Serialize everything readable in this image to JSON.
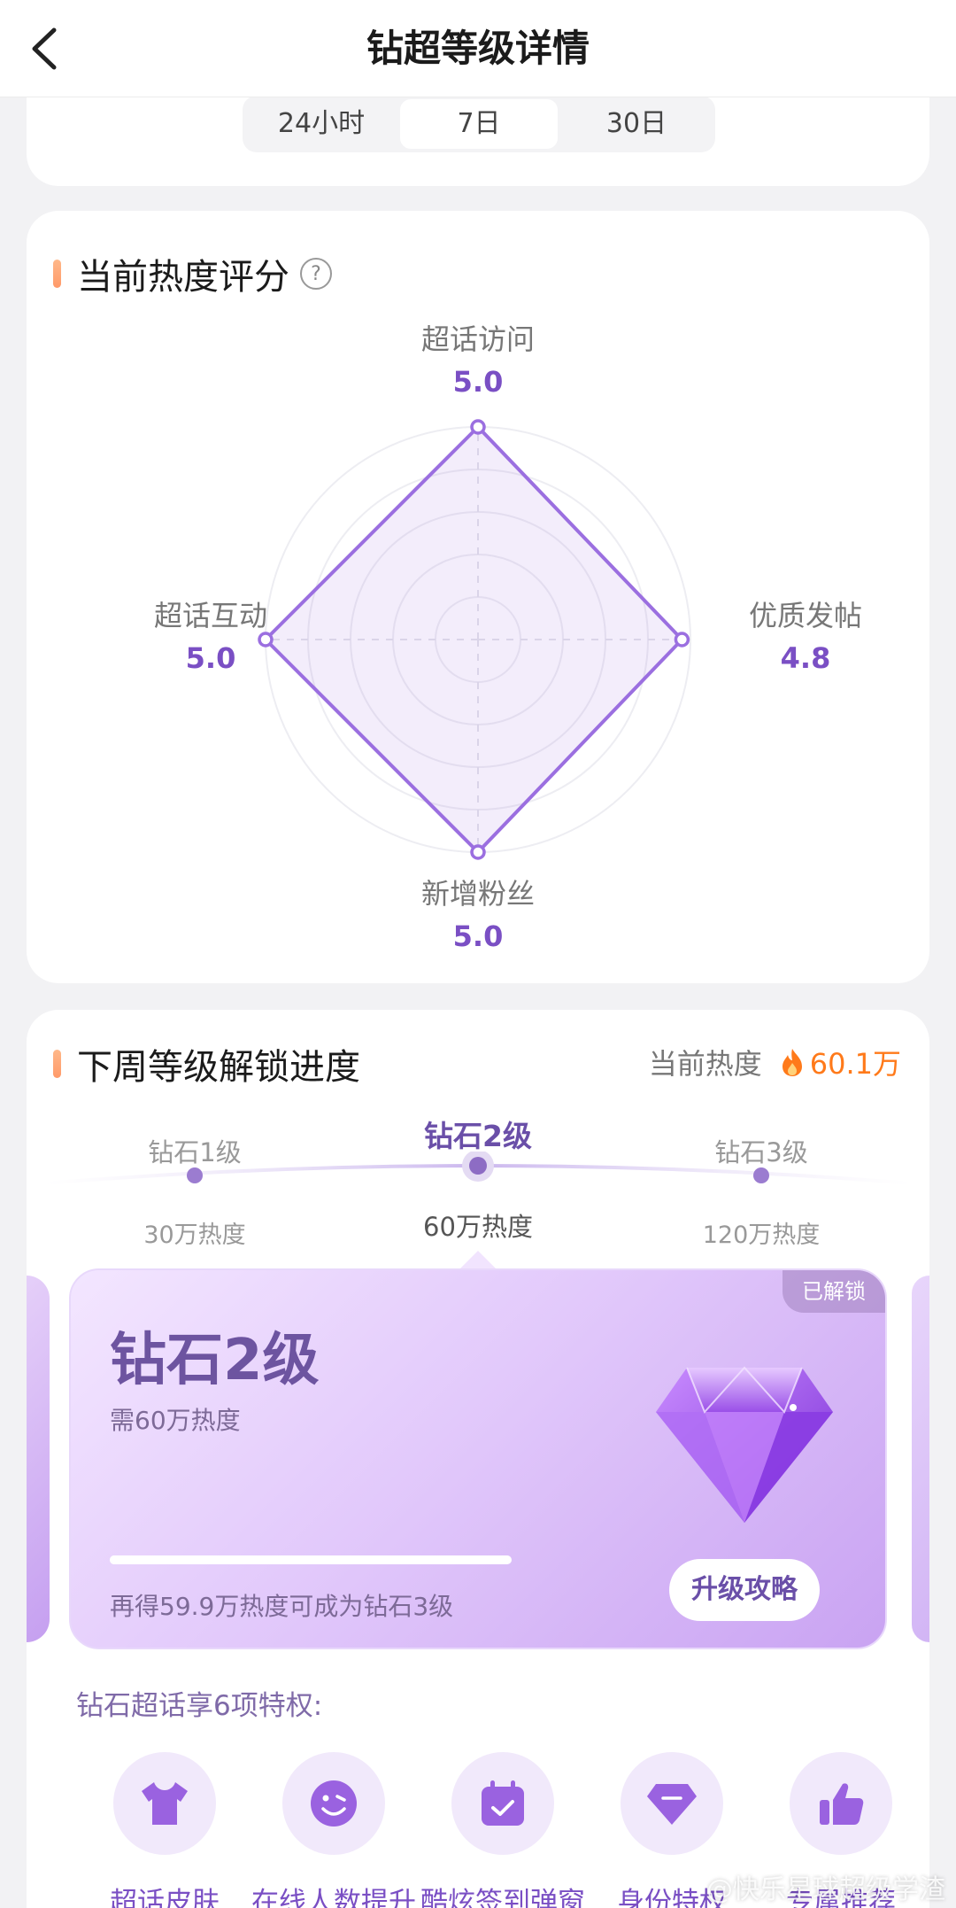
{
  "nav": {
    "title": "钻超等级详情"
  },
  "tabs": [
    "24小时",
    "7日",
    "30日"
  ],
  "radar": {
    "section_title": "当前热度评分",
    "axes": [
      {
        "name": "超话访问",
        "value": "5.0"
      },
      {
        "name": "优质发帖",
        "value": "4.8"
      },
      {
        "name": "新增粉丝",
        "value": "5.0"
      },
      {
        "name": "超话互动",
        "value": "5.0"
      }
    ]
  },
  "chart_data": {
    "type": "radar",
    "title": "当前热度评分",
    "axes": [
      "超话访问",
      "优质发帖",
      "新增粉丝",
      "超话互动"
    ],
    "values": [
      5.0,
      4.8,
      5.0,
      5.0
    ],
    "range": [
      0,
      5
    ]
  },
  "level": {
    "section_title": "下周等级解锁进度",
    "heat_label": "当前热度",
    "heat_value": "60.1万",
    "nodes": [
      {
        "name": "钻石1级",
        "heat": "30万热度"
      },
      {
        "name": "钻石2级",
        "heat": "60万热度"
      },
      {
        "name": "钻石3级",
        "heat": "120万热度"
      }
    ],
    "card": {
      "badge": "已解锁",
      "title": "钻石2级",
      "subtitle": "需60万热度",
      "progress": 0.998,
      "hint": "再得59.9万热度可成为钻石3级",
      "button": "升级攻略"
    },
    "privileges_title": "钻石超话享6项特权:",
    "privileges": [
      {
        "label": "超话皮肤",
        "icon": "tshirt-icon"
      },
      {
        "label": "在线人数提升",
        "icon": "smile-face-icon"
      },
      {
        "label": "酷炫签到弹窗",
        "icon": "calendar-check-icon"
      },
      {
        "label": "身份特权",
        "icon": "diamond-badge-icon"
      },
      {
        "label": "专属推荐",
        "icon": "thumbs-up-icon"
      }
    ]
  },
  "colors": {
    "accent": "#7a4fc4",
    "heat": "#ff7a1a",
    "radar_stroke": "#9b6fe0"
  },
  "watermark": "@快乐星球超级学渣"
}
